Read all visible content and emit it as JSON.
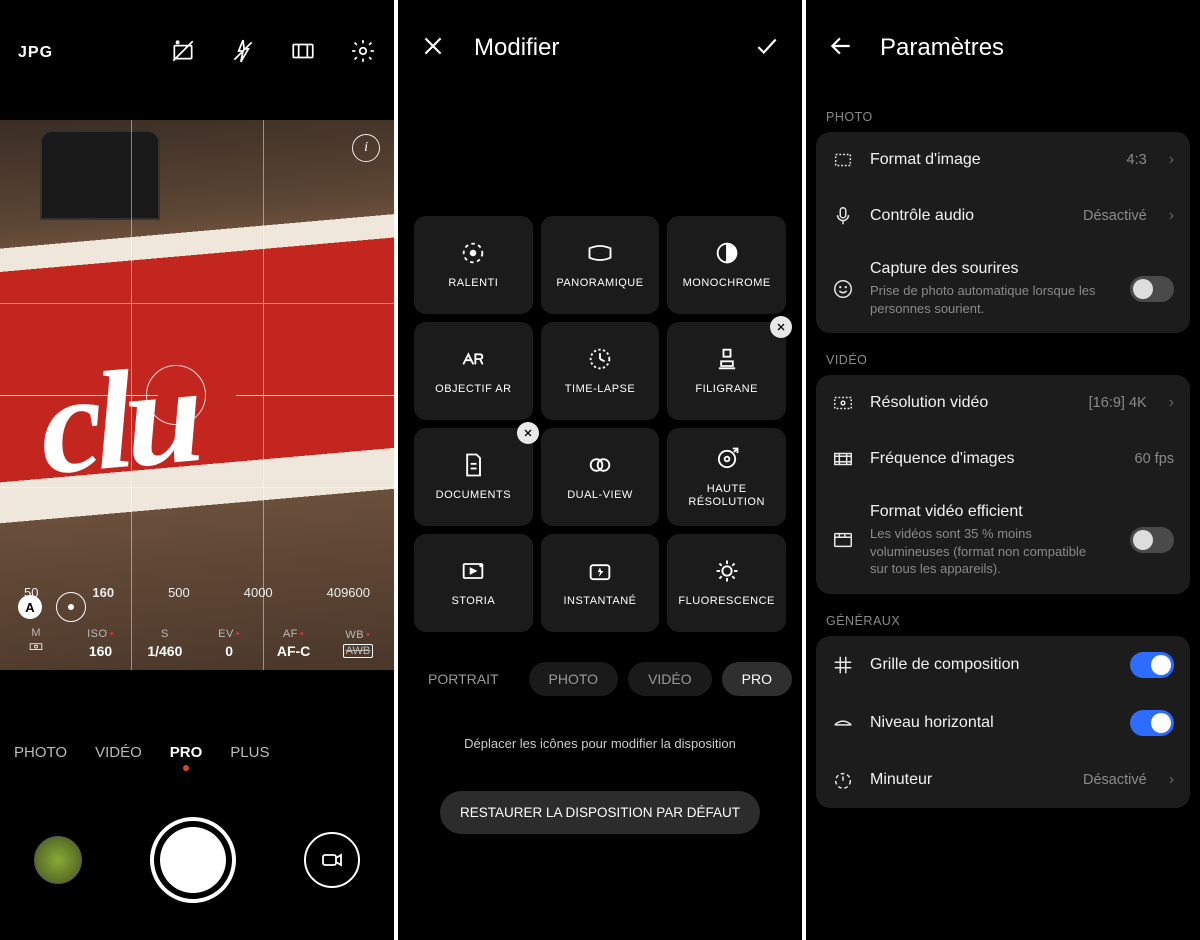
{
  "panel1": {
    "format": "JPG",
    "info_icon": "i",
    "iso_scale": [
      "50",
      "160",
      "500",
      "4000",
      "409600"
    ],
    "iso_selected": "160",
    "auto_badge": "A",
    "params": [
      {
        "label": "M",
        "value": "",
        "icon": "meter"
      },
      {
        "label": "ISO",
        "value": "160",
        "dot": true
      },
      {
        "label": "S",
        "value": "1/460"
      },
      {
        "label": "EV",
        "value": "0",
        "dot": true
      },
      {
        "label": "AF",
        "value": "AF-C",
        "dot": true
      },
      {
        "label": "WB",
        "value": "AWB",
        "dot": true,
        "awb": true
      }
    ],
    "modes": [
      "PHOTO",
      "VIDÉO",
      "PRO",
      "PLUS"
    ],
    "mode_selected": "PRO"
  },
  "panel2": {
    "title": "Modifier",
    "tiles": [
      {
        "label": "RALENTI",
        "icon": "ralenti"
      },
      {
        "label": "PANORAMIQUE",
        "icon": "pano"
      },
      {
        "label": "MONOCHROME",
        "icon": "mono"
      },
      {
        "label": "OBJECTIF AR",
        "icon": "ar"
      },
      {
        "label": "TIME-LAPSE",
        "icon": "timelapse"
      },
      {
        "label": "FILIGRANE",
        "icon": "stamp",
        "badge": true
      },
      {
        "label": "DOCUMENTS",
        "icon": "doc",
        "badge": true
      },
      {
        "label": "DUAL-VIEW",
        "icon": "dual"
      },
      {
        "label": "HAUTE RÉSOLUTION",
        "icon": "hires"
      },
      {
        "label": "STORIA",
        "icon": "storia"
      },
      {
        "label": "INSTANTANÉ",
        "icon": "instant"
      },
      {
        "label": "FLUORESCENCE",
        "icon": "fluor"
      }
    ],
    "pills": [
      "PORTRAIT",
      "PHOTO",
      "VIDÉO",
      "PRO"
    ],
    "pill_selected": "PRO",
    "hint": "Déplacer les icônes pour modifier la disposition",
    "restore": "RESTAURER LA DISPOSITION PAR DÉFAUT"
  },
  "panel3": {
    "title": "Paramètres",
    "sections": [
      {
        "label": "PHOTO",
        "rows": [
          {
            "icon": "aspect",
            "title": "Format d'image",
            "value": "4:3",
            "chev": true
          },
          {
            "icon": "mic",
            "title": "Contrôle audio",
            "value": "Désactivé",
            "chev": true
          },
          {
            "icon": "smile",
            "title": "Capture des sourires",
            "sub": "Prise de photo automatique lorsque les personnes sourient.",
            "toggle": false
          }
        ]
      },
      {
        "label": "VIDÉO",
        "rows": [
          {
            "icon": "vres",
            "title": "Résolution vidéo",
            "value": "[16:9] 4K",
            "chev": true
          },
          {
            "icon": "fps",
            "title": "Fréquence d'images",
            "value": "60 fps"
          },
          {
            "icon": "vfmt",
            "title": "Format vidéo efficient",
            "sub": "Les vidéos sont 35 % moins volumineuses (format non compatible sur tous les appareils).",
            "toggle": false
          }
        ]
      },
      {
        "label": "GÉNÉRAUX",
        "rows": [
          {
            "icon": "grid",
            "title": "Grille de composition",
            "toggle": true
          },
          {
            "icon": "level",
            "title": "Niveau horizontal",
            "toggle": true
          },
          {
            "icon": "timer",
            "title": "Minuteur",
            "value": "Désactivé",
            "chev": true
          }
        ]
      }
    ]
  }
}
